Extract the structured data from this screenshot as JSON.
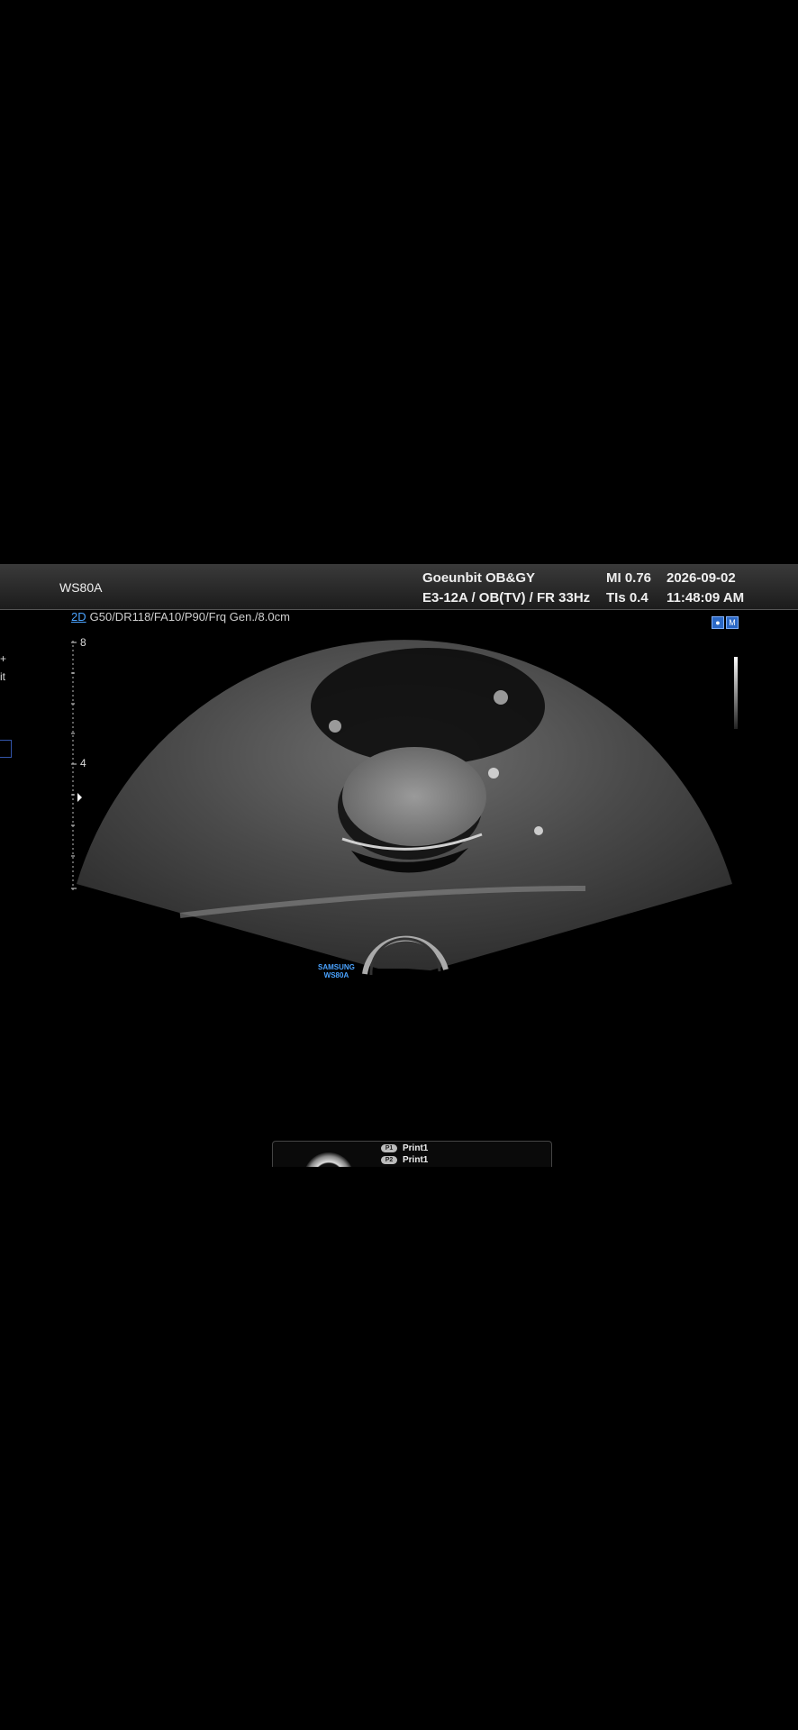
{
  "header": {
    "device": "WS80A",
    "institution": "Goeunbit OB&GY",
    "probe_preset": "E3-12A / OB(TV) / FR 33Hz",
    "mi": "MI  0.76",
    "tis": "TIs 0.4",
    "date": "2026-09-02",
    "time": "11:48:09 AM"
  },
  "params": {
    "mode": "2D",
    "settings": "G50/DR118/FA10/P90/Frq Gen./8.0cm"
  },
  "depth_scale": {
    "top_label": "8",
    "mid_label": "4"
  },
  "left_menu": {
    "plus": "+",
    "item": "it"
  },
  "logo": {
    "line1": "SAMSUNG",
    "line2": "WS80A"
  },
  "print_panel": {
    "rows": [
      {
        "key": "P1",
        "label": "Print1"
      },
      {
        "key": "P2",
        "label": "Print1"
      }
    ]
  },
  "icons": [
    "camera-icon",
    "m-mode-icon"
  ]
}
